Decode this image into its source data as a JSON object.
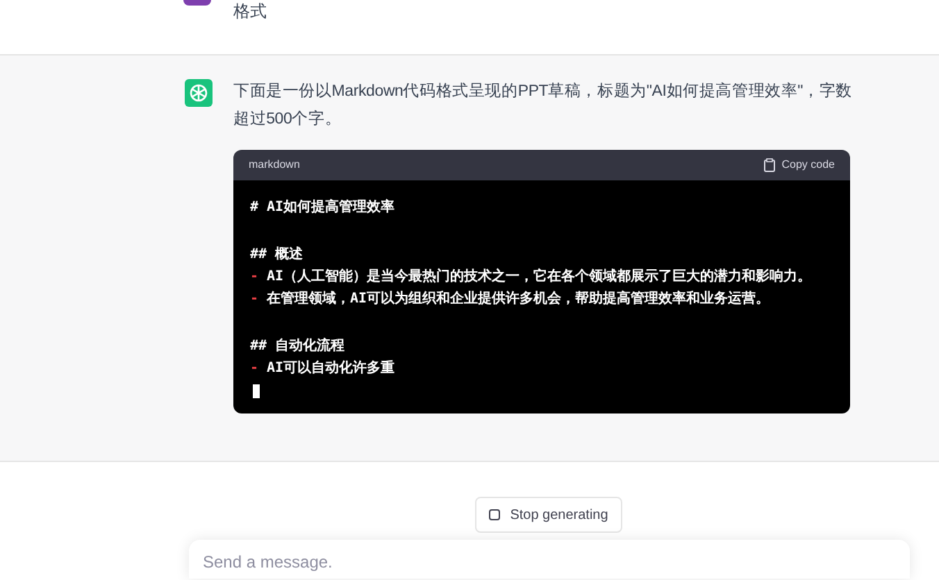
{
  "user_message": {
    "text": "格式"
  },
  "assistant_message": {
    "text": "下面是一份以Markdown代码格式呈现的PPT草稿，标题为\"AI如何提高管理效率\"，字数超过500个字。",
    "code_block": {
      "language": "markdown",
      "copy_label": "Copy code",
      "lines": [
        {
          "kind": "text",
          "text": "# AI如何提高管理效率"
        },
        {
          "kind": "blank"
        },
        {
          "kind": "text",
          "text": "## 概述"
        },
        {
          "kind": "bullet",
          "marker": "-",
          "text": "AI（人工智能）是当今最热门的技术之一，它在各个领域都展示了巨大的潜力和影响力。"
        },
        {
          "kind": "bullet",
          "marker": "-",
          "text": "在管理领域，AI可以为组织和企业提供许多机会，帮助提高管理效率和业务运营。"
        },
        {
          "kind": "blank"
        },
        {
          "kind": "text",
          "text": "## 自动化流程"
        },
        {
          "kind": "bullet",
          "marker": "-",
          "text": "AI可以自动化许多重"
        },
        {
          "kind": "cursor"
        }
      ]
    }
  },
  "stop_button": {
    "label": "Stop generating"
  },
  "composer": {
    "placeholder": "Send a message."
  }
}
